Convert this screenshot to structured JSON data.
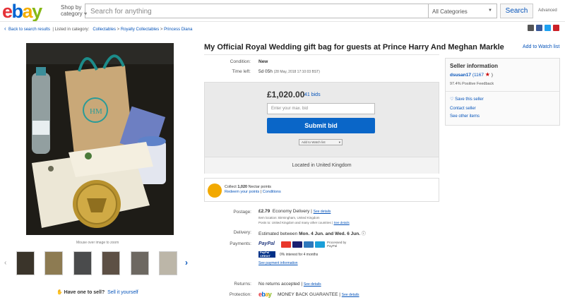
{
  "header": {
    "logo": {
      "e": "e",
      "b": "b",
      "a": "a",
      "y": "y"
    },
    "shop_by": "Shop by",
    "category": "category",
    "search_placeholder": "Search for anything",
    "category_select": "All Categories",
    "search_button": "Search",
    "advanced": "Advanced"
  },
  "breadcrumb": {
    "back": "Back to search results",
    "listed_in": "Listed in category:",
    "items": [
      "Collectables",
      "Royalty Collectables",
      "Princess Diana"
    ]
  },
  "gallery": {
    "zoom_hint": "Mouse over image to zoom",
    "have_one": "Have one to sell?",
    "sell_it": "Sell it yourself"
  },
  "listing": {
    "title": "My Official Royal Wedding gift bag for guests at Prince Harry And Meghan Markle",
    "add_to_watch": "Add to Watch list",
    "condition_label": "Condition:",
    "condition": "New",
    "time_left_label": "Time left:",
    "time_left": "5d 05h",
    "time_left_detail": "(28 May, 2018  17:10:03 BST)",
    "price": "£1,020.00",
    "bids": "41 bids",
    "bid_placeholder": "Enter your max. bid",
    "submit_bid": "Submit bid",
    "add_watch_small": "Add to Watch list",
    "located": "Located in United Kingdom",
    "nectar_collect": "Collect",
    "nectar_points": "1,020",
    "nectar_text": "Nectar points",
    "nectar_redeem": "Redeem your points",
    "nectar_conditions": "Conditions",
    "postage_label": "Postage:",
    "postage_price": "£2.79",
    "postage_type": "Economy Delivery",
    "see_details": "See details",
    "item_location": "Item location:  Birmingham, United Kingdom",
    "posts_to": "Posts to:  United Kingdom and many other countries",
    "delivery_label": "Delivery:",
    "delivery": "Estimated between",
    "delivery_dates": "Mon. 4 Jun. and Wed. 6 Jun.",
    "payments_label": "Payments:",
    "paypal": "PayPal",
    "processed": "Processed by PayPal",
    "paypal_credit": "PayPal CREDIT",
    "credit_text": "0% interest for 4 months",
    "see_payment": "See payment information",
    "returns_label": "Returns:",
    "returns": "No returns accepted",
    "protection_label": "Protection:",
    "protection": "MONEY BACK GUARANTEE"
  },
  "seller": {
    "heading": "Seller information",
    "name": "dsusan17",
    "score": "(1167",
    "feedback": "97.4% Positive Feedback",
    "save": "Save this seller",
    "contact": "Contact seller",
    "other": "See other items"
  },
  "colors": {
    "ebay_blue": "#0654ba",
    "bid_button": "#0a66c8"
  }
}
